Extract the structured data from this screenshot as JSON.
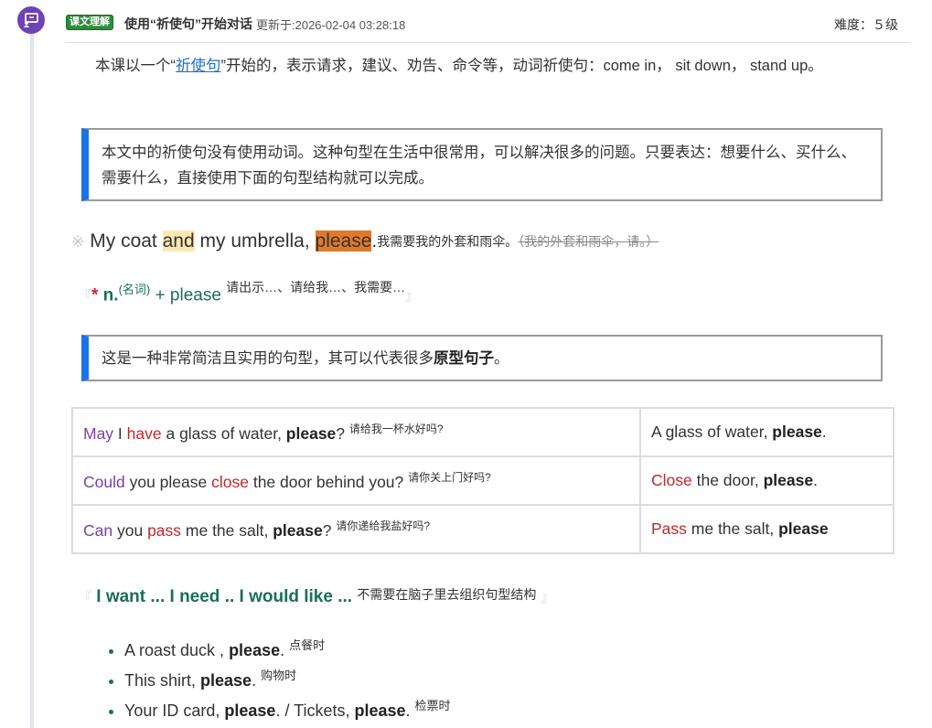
{
  "header": {
    "tag": "课文理解",
    "title": "使用“祈使句”开始对话",
    "updated": "更新于:2026-02-04 03:28:18",
    "difficulty": "难度：５级"
  },
  "intro": {
    "prefix": "本课以一个“",
    "link": "祈使句",
    "suffix": "”开始的，表示请求，建议、劝告、命令等，动词祈使句：come in， sit down， stand up。"
  },
  "callout1": "本文中的祈使句没有使用动词。这种句型在生活中很常用，可以解决很多的问题。只要表达：想要什么、买什么、需要什么，直接使用下面的句型结构就可以完成。",
  "example": {
    "mark": "※",
    "p1": "My coat ",
    "and": "and",
    "p2": " my umbrella, ",
    "please": "please",
    "dot": ".",
    "translation": "我需要我的外套和雨伞。",
    "struck": "（我的外套和雨伞，请。）"
  },
  "pattern1": {
    "open": "『",
    "star": "*",
    "noun": " n.",
    "noun_sup": "(名词)",
    "plus": " + please ",
    "note": "请出示…、请给我…、我需要…",
    "close": "』"
  },
  "callout2": {
    "text": "这是一种非常简洁且实用的句型，其可以代表很多",
    "bold": "原型句子",
    "end": "。"
  },
  "table": {
    "rows": [
      {
        "a1": "May",
        "a2": " I ",
        "a3": "have",
        "a4": " a glass of water, ",
        "a5": "please",
        "a6": "?",
        "note": "请给我一杯水好吗?",
        "b1": "",
        "b2": "A glass of water, ",
        "b3": "please",
        "b4": "."
      },
      {
        "a1": "Could",
        "a2": " you please ",
        "a3": "close",
        "a4": " the door behind you? ",
        "a5": "",
        "a6": "",
        "note": "请你关上门好吗?",
        "b1": "Close",
        "b2": " the door, ",
        "b3": "please",
        "b4": "."
      },
      {
        "a1": "Can",
        "a2": " you ",
        "a3": "pass",
        "a4": " me the salt, ",
        "a5": "please",
        "a6": "?",
        "note": "请你递给我盐好吗?",
        "b1": "Pass",
        "b2": " me the salt, ",
        "b3": "please",
        "b4": ""
      }
    ]
  },
  "pattern2": {
    "open": "『",
    "text": " I want ... I need .. I would like ... ",
    "note": "不需要在脑子里去组织句型结构",
    "close": "』"
  },
  "bullets": [
    {
      "t1": "A roast duck , ",
      "b": "please",
      "t2": ".",
      "note": "点餐时"
    },
    {
      "t1": "This shirt, ",
      "b": "please",
      "t2": ".",
      "note": "购物时"
    },
    {
      "t1": "Your ID card, ",
      "b": "please",
      "t2": ". / Tickets, ",
      "b2": "please",
      "t3": ".",
      "note": "检票时"
    }
  ]
}
